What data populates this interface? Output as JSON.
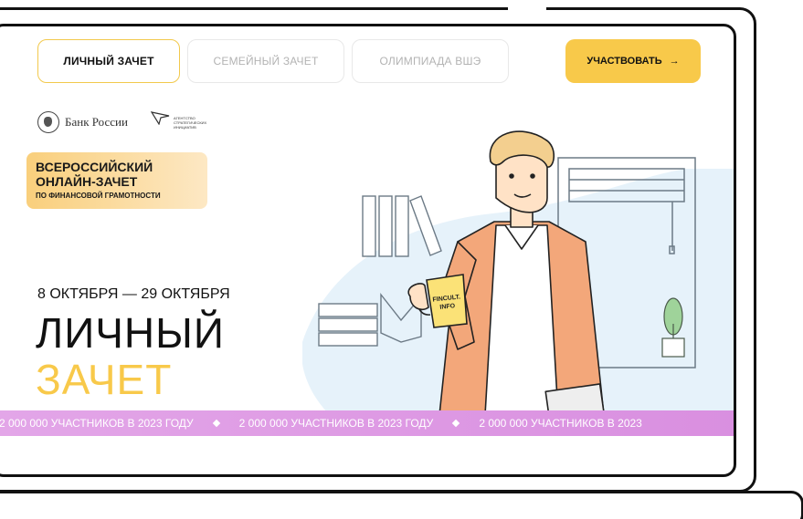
{
  "nav": {
    "tabs": [
      {
        "label": "ЛИЧНЫЙ ЗАЧЕТ",
        "active": true
      },
      {
        "label": "СЕМЕЙНЫЙ ЗАЧЕТ",
        "active": false
      },
      {
        "label": "ОЛИМПИАДА ВШЭ",
        "active": false
      }
    ],
    "cta_label": "УЧАСТВОВАТЬ",
    "cta_arrow": "→"
  },
  "logos": {
    "bank": "Банк России",
    "asi_lines": [
      "АГЕНТСТВО",
      "СТРАТЕГИЧЕСКИХ",
      "ИНИЦИАТИВ"
    ]
  },
  "badge": {
    "line1": "ВСЕРОССИЙСКИЙ",
    "line2": "ОНЛАЙН-ЗАЧЕТ",
    "line3": "ПО ФИНАНСОВОЙ ГРАМОТНОСТИ"
  },
  "hero": {
    "dates": "8 ОКТЯБРЯ — 29 ОКТЯБРЯ",
    "title_line1": "ЛИЧНЫЙ",
    "title_line2": "ЗАЧЕТ"
  },
  "mug": {
    "line1": "FINCULT.",
    "line2": "INFO"
  },
  "ticker": {
    "items": [
      "2 000 000 УЧАСТНИКОВ В 2023 ГОДУ",
      "2 000 000 УЧАСТНИКОВ В 2023 ГОДУ",
      "2 000 000 УЧАСТНИКОВ В 2023"
    ]
  },
  "colors": {
    "accent_yellow": "#f8c94a",
    "ticker_purple": "#d98fe0",
    "illustration_blue": "#e6f2fa",
    "shirt_orange": "#f3a77a"
  }
}
